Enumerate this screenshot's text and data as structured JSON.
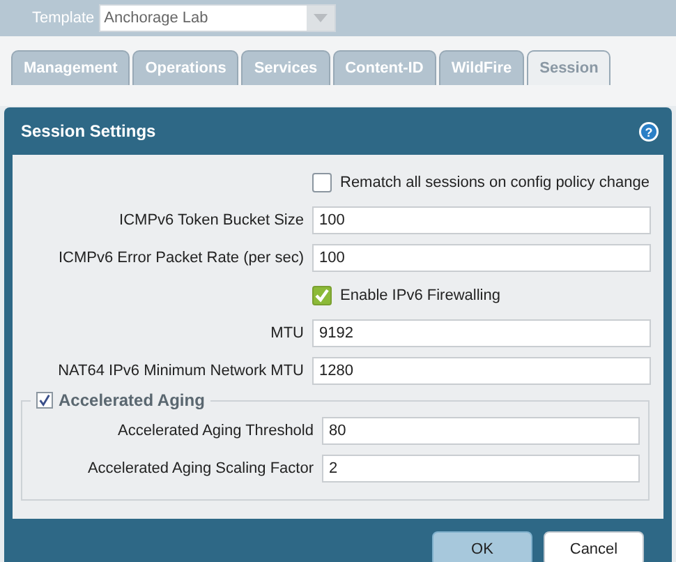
{
  "template": {
    "label": "Template",
    "value": "Anchorage Lab"
  },
  "tabs": [
    {
      "label": "Management",
      "selected": false
    },
    {
      "label": "Operations",
      "selected": false
    },
    {
      "label": "Services",
      "selected": false
    },
    {
      "label": "Content-ID",
      "selected": false
    },
    {
      "label": "WildFire",
      "selected": false
    },
    {
      "label": "Session",
      "selected": true
    }
  ],
  "dialog": {
    "title": "Session Settings",
    "help": "?",
    "rows": [
      {
        "kind": "checkbox",
        "label": "Rematch all sessions on config policy change",
        "checked": false
      },
      {
        "kind": "field",
        "label": "ICMPv6 Token Bucket Size",
        "value": "100"
      },
      {
        "kind": "field",
        "label": "ICMPv6 Error Packet Rate (per sec)",
        "value": "100"
      },
      {
        "kind": "checkbox",
        "label": "Enable IPv6 Firewalling",
        "checked": true
      },
      {
        "kind": "field",
        "label": "MTU",
        "value": "9192"
      },
      {
        "kind": "field",
        "label": "NAT64 IPv6 Minimum Network MTU",
        "value": "1280"
      }
    ],
    "aging": {
      "label": "Accelerated Aging",
      "checked": true,
      "rows": [
        {
          "kind": "field",
          "label": "Accelerated Aging Threshold",
          "value": "80"
        },
        {
          "kind": "field",
          "label": "Accelerated Aging Scaling Factor",
          "value": "2"
        }
      ]
    },
    "buttons": [
      {
        "label": "OK",
        "kind": "primary"
      },
      {
        "label": "Cancel",
        "kind": "secondary"
      }
    ]
  }
}
